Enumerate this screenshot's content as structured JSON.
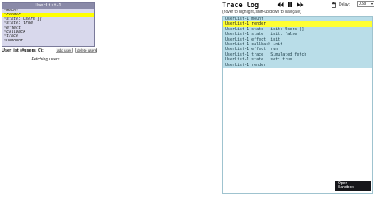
{
  "component": {
    "title": "UserList-1",
    "hooks": [
      {
        "label": "~mount",
        "active": false
      },
      {
        "label": "~render",
        "active": true
      },
      {
        "label": "~state: Users []",
        "active": false
      },
      {
        "label": "~state: true",
        "active": false
      },
      {
        "label": "~effect",
        "active": false
      },
      {
        "label": "~callback",
        "active": false
      },
      {
        "label": "~trace",
        "active": false
      },
      {
        "label": "~unmount",
        "active": false
      }
    ]
  },
  "user_list": {
    "title": "User list (#users: 0):",
    "add_label": "add user",
    "delete_label": "delete users",
    "status": "Fetching users.."
  },
  "trace": {
    "title": "Trace log",
    "hint": "(hover to highlight, shift-up/down to navigate)",
    "delay_label": "Delay:",
    "delay_value": "0.5s",
    "rows": [
      {
        "text": "UserList-1 mount",
        "active": false
      },
      {
        "text": "UserList-1 render",
        "active": true
      },
      {
        "text": "UserList-1 state   init: Users []",
        "active": false
      },
      {
        "text": "UserList-1 state   init: false",
        "active": false
      },
      {
        "text": "UserList-1 effect  init",
        "active": false
      },
      {
        "text": "UserList-1 callback init",
        "active": false
      },
      {
        "text": "UserList-1 effect  run",
        "active": false
      },
      {
        "text": "UserList-1 trace   Simulated fetch",
        "active": false
      },
      {
        "text": "UserList-1 state   set: true",
        "active": false
      },
      {
        "text": "UserList-1 render",
        "active": false
      }
    ]
  },
  "sandbox": {
    "line1": "Open",
    "line2": "Sandbox"
  },
  "icons": {
    "rewind": "rewind-icon",
    "pause": "pause-icon",
    "forward": "fast-forward-icon",
    "trash": "trash-icon"
  }
}
